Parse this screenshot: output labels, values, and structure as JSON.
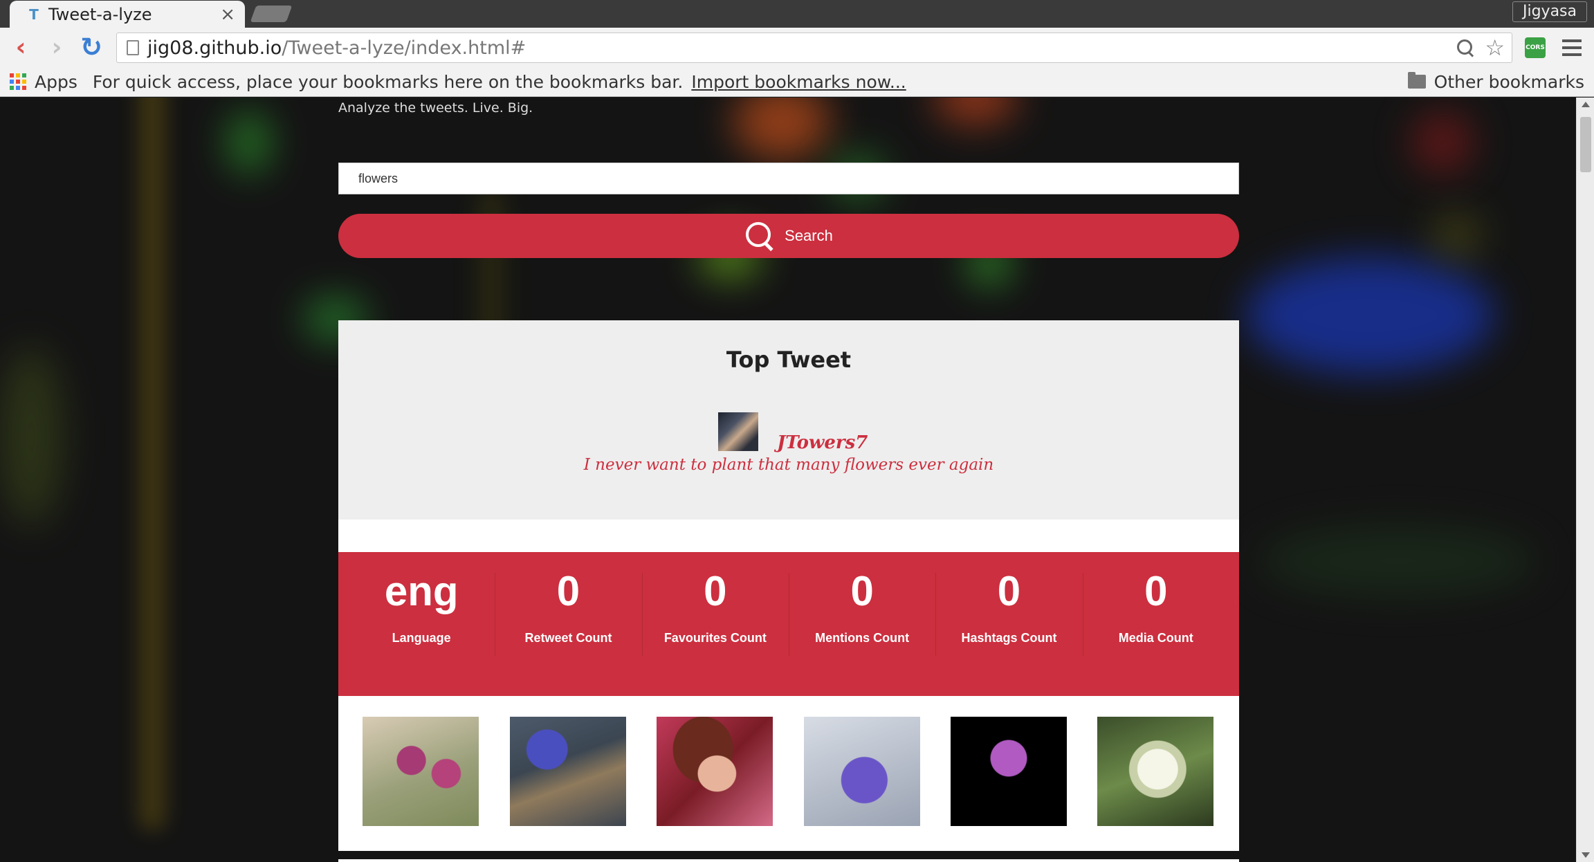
{
  "browser": {
    "tab_title": "Tweet-a-lyze",
    "tab_close": "×",
    "profile": "Jigyasa",
    "url_host": "jig08.github.io",
    "url_path": "/Tweet-a-lyze/index.html#",
    "extension_label": "CORS",
    "bookmarks": {
      "apps_label": "Apps",
      "hint": "For quick access, place your bookmarks here on the bookmarks bar.",
      "import_link": "Import bookmarks now...",
      "other_label": "Other bookmarks"
    }
  },
  "page": {
    "tagline": "Analyze the tweets. Live. Big.",
    "search": {
      "value": "flowers",
      "button_label": "Search"
    },
    "top_tweet": {
      "title": "Top Tweet",
      "username": "JTowers7",
      "text": "I never want to plant that many flowers ever again"
    },
    "stats": [
      {
        "value": "eng",
        "label": "Language"
      },
      {
        "value": "0",
        "label": "Retweet Count"
      },
      {
        "value": "0",
        "label": "Favourites Count"
      },
      {
        "value": "0",
        "label": "Mentions Count"
      },
      {
        "value": "0",
        "label": "Hashtags Count"
      },
      {
        "value": "0",
        "label": "Media Count"
      }
    ],
    "gallery_images": [
      "pink-pasque-flowers",
      "hyacinth-with-tag",
      "woman-among-flowers",
      "purple-bouquet",
      "purple-allium",
      "white-ranunculus"
    ]
  },
  "colors": {
    "accent": "#cc2f3f",
    "panel": "#eeeeee"
  }
}
